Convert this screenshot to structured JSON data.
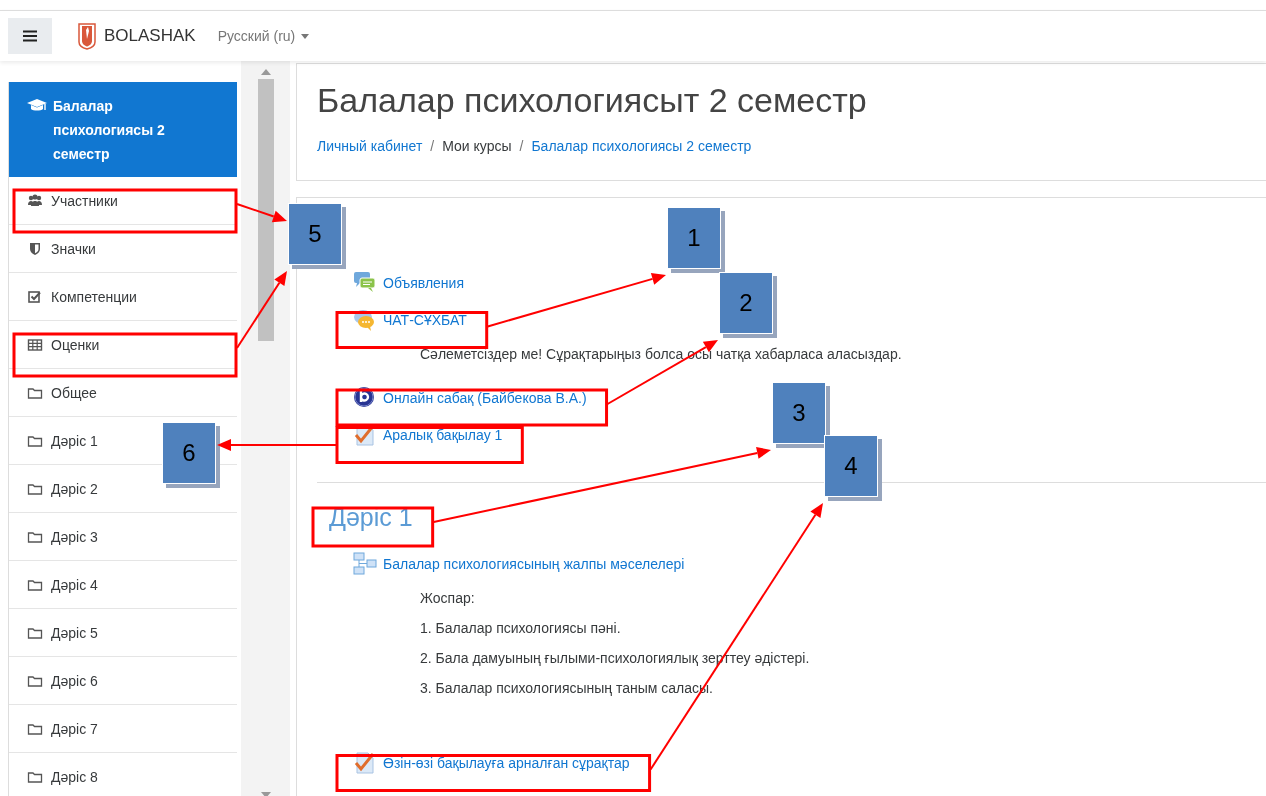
{
  "navbar": {
    "brand": "BOLASHAK",
    "language": "Русский (ru)"
  },
  "sidebar": {
    "course": {
      "label": "Балалар психологиясы 2 семестр",
      "selected": true
    },
    "items": [
      {
        "label": "Участники",
        "kind": "participants",
        "selected": false,
        "highlighted": true
      },
      {
        "label": "Значки",
        "kind": "badges",
        "selected": false,
        "highlighted": false
      },
      {
        "label": "Компетенции",
        "kind": "competencies",
        "selected": false,
        "highlighted": false
      },
      {
        "label": "Оценки",
        "kind": "grades",
        "selected": false,
        "highlighted": true
      },
      {
        "label": "Общее",
        "kind": "section",
        "selected": false,
        "highlighted": false
      },
      {
        "label": "Дәріс 1",
        "kind": "section",
        "selected": false,
        "highlighted": false
      },
      {
        "label": "Дәріс 2",
        "kind": "section",
        "selected": false,
        "highlighted": false
      },
      {
        "label": "Дәріс 3",
        "kind": "section",
        "selected": false,
        "highlighted": false
      },
      {
        "label": "Дәріс 4",
        "kind": "section",
        "selected": false,
        "highlighted": false
      },
      {
        "label": "Дәріс 5",
        "kind": "section",
        "selected": false,
        "highlighted": false
      },
      {
        "label": "Дәріс 6",
        "kind": "section",
        "selected": false,
        "highlighted": false
      },
      {
        "label": "Дәріс 7",
        "kind": "section",
        "selected": false,
        "highlighted": false
      },
      {
        "label": "Дәріс 8",
        "kind": "section",
        "selected": false,
        "highlighted": false
      }
    ]
  },
  "page": {
    "title": "Балалар психологиясыт 2 семестр",
    "breadcrumb": [
      {
        "label": "Личный кабинет",
        "kind": "link"
      },
      {
        "label": "/",
        "kind": "separator"
      },
      {
        "label": "Мои курсы",
        "kind": "text"
      },
      {
        "label": "/",
        "kind": "separator"
      },
      {
        "label": "Балалар психологиясы 2 семестр",
        "kind": "link"
      }
    ]
  },
  "sections": [
    {
      "activities": [
        {
          "kind": "forum",
          "label": "Объявления",
          "highlighted": false
        },
        {
          "kind": "chat",
          "label": "ЧАТ-СҰХБАТ",
          "highlighted": true,
          "description": [
            "Сәлеметсіздер ме! Сұрақтарыңыз болса осы чатқа хабарласа аласыздар."
          ]
        },
        {
          "kind": "conference",
          "label": "Онлайн сабақ (Байбекова В.А.)",
          "highlighted": true
        },
        {
          "kind": "quiz",
          "label": "Аралық бақылау 1",
          "highlighted": true
        }
      ]
    },
    {
      "title": "Дәріс 1",
      "title_highlighted": true,
      "activities": [
        {
          "kind": "book",
          "label": "Балалар психологиясының жалпы мәселелері",
          "highlighted": false,
          "description": [
            "Жоспар:",
            "1. Балалар психологиясы пәні.",
            "2. Бала дамуының ғылыми-психологиялық зерттеу әдістері.",
            "3. Балалар психологиясының таным саласы."
          ]
        },
        {
          "kind": "quiz",
          "label": "Өзін-өзі бақылауға арналған сұрақтар",
          "highlighted": true
        }
      ]
    }
  ],
  "callouts": [
    {
      "label": "5"
    },
    {
      "label": "1"
    },
    {
      "label": "2"
    },
    {
      "label": "3"
    },
    {
      "label": "6"
    },
    {
      "label": "4"
    }
  ]
}
